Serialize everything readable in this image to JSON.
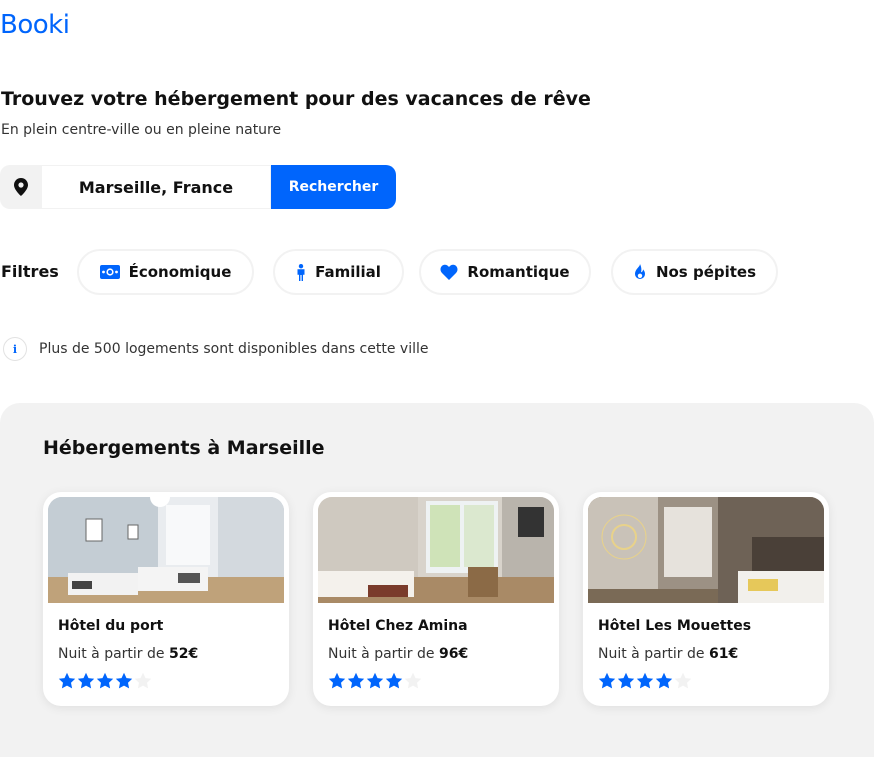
{
  "brand": {
    "logo": "Booki"
  },
  "hero": {
    "title": "Trouvez votre hébergement pour des vacances de rêve",
    "subtitle": "En plein centre-ville ou en pleine nature"
  },
  "search": {
    "icon": "map-pin-icon",
    "value": "Marseille, France",
    "button_label": "Rechercher"
  },
  "filters": {
    "label": "Filtres",
    "items": [
      {
        "label": "Économique",
        "icon": "money-icon"
      },
      {
        "label": "Familial",
        "icon": "person-icon"
      },
      {
        "label": "Romantique",
        "icon": "heart-icon"
      },
      {
        "label": "Nos pépites",
        "icon": "fire-icon"
      }
    ]
  },
  "info": {
    "icon": "info-icon",
    "text": "Plus de 500 logements sont disponibles dans cette ville"
  },
  "listings": {
    "title": "Hébergements à Marseille",
    "price_prefix": "Nuit à partir de",
    "currency": "€",
    "cards": [
      {
        "name": "Hôtel du port",
        "price": "52",
        "rating": 4,
        "max_rating": 5
      },
      {
        "name": "Hôtel Chez Amina",
        "price": "96",
        "rating": 4,
        "max_rating": 5
      },
      {
        "name": "Hôtel Les Mouettes",
        "price": "61",
        "rating": 4,
        "max_rating": 5
      }
    ]
  },
  "colors": {
    "accent": "#0065fc",
    "panel_bg": "#f2f2f2",
    "star_empty": "#f2f2f2"
  }
}
